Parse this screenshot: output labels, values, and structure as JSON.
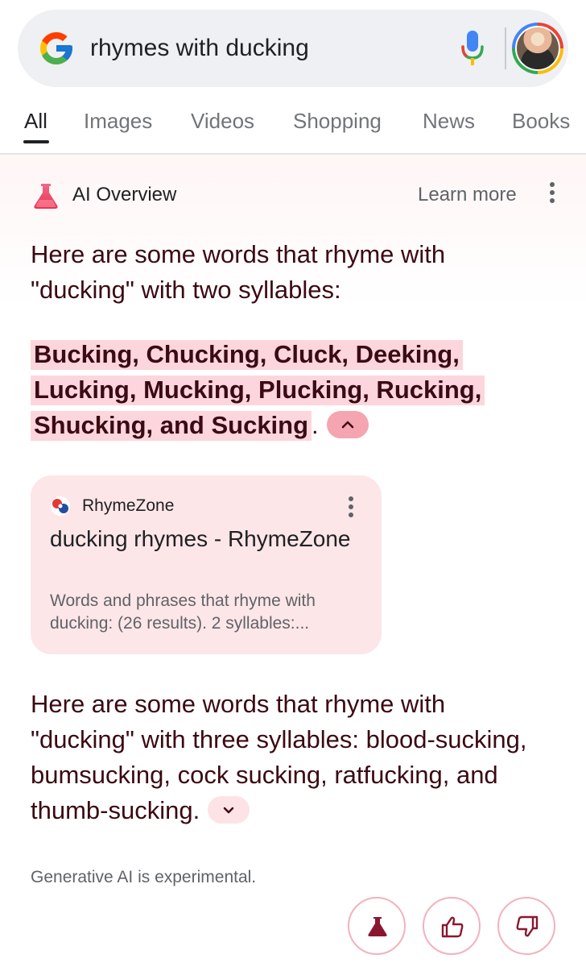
{
  "search": {
    "query": "rhymes with ducking"
  },
  "tabs": [
    "All",
    "Images",
    "Videos",
    "Shopping",
    "News",
    "Books"
  ],
  "ai_overview": {
    "title": "AI Overview",
    "learn_more": "Learn more",
    "intro_two": "Here are some words that rhyme with \"ducking\" with two syllables:",
    "two_syllable_list": "Bucking, Chucking, Cluck, Deeking, Lucking, Mucking, Plucking, Rucking, Shucking, and Sucking",
    "two_syllable_end": ".",
    "three_syllable_text": "Here are some words that rhyme with \"ducking\" with three syllables: blood-sucking, bumsucking, cock sucking, ratfucking, and thumb-sucking.",
    "disclaimer": "Generative AI is experimental."
  },
  "source_card": {
    "site_name": "RhymeZone",
    "title": "ducking rhymes - RhymeZone",
    "snippet": "Words and phrases that rhyme with ducking: (26 results). 2 syllables:..."
  },
  "icons": {
    "brand": "google-g-logo",
    "mic": "microphone-icon",
    "labs": "flask-icon",
    "feedback_positive": "thumbs-up-icon",
    "feedback_negative": "thumbs-down-icon"
  },
  "colors": {
    "accent_text": "#3b0a12",
    "highlight": "#fcd6dc",
    "card_bg": "#fde6e8",
    "flask_gradient_top": "#f06a8a",
    "flask_gradient_bottom": "#e8334f"
  }
}
